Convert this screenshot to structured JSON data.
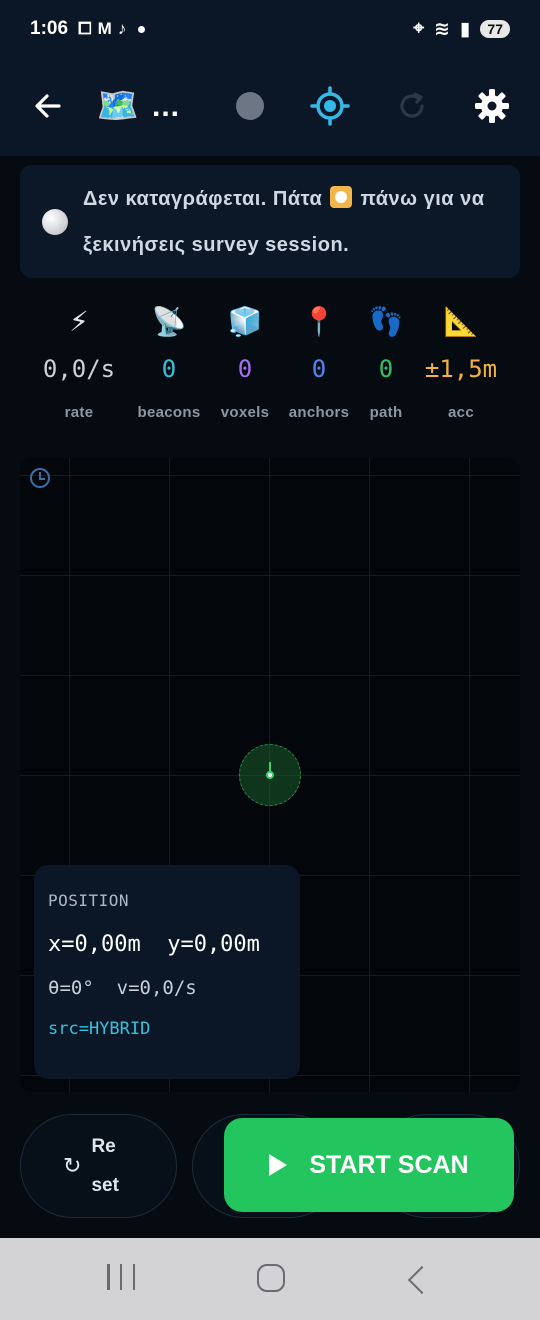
{
  "status_bar": {
    "time": "1:06",
    "battery": "77"
  },
  "toolbar": {
    "map_emoji": "🗺️",
    "more_label": "...",
    "icons": {
      "back": "arrow-left-icon",
      "record": "record-dot-icon",
      "locate": "crosshair-icon",
      "refresh": "refresh-icon",
      "settings": "gear-icon"
    },
    "locate_color": "#34b8e8"
  },
  "banner": {
    "text_before": "Δεν καταγράφεται. Πάτα",
    "text_after": "πάνω για να ξεκινήσεις survey session."
  },
  "stats": [
    {
      "icon": "⚡",
      "value": "0,0/s",
      "label": "rate",
      "color": "#c9d2dd"
    },
    {
      "icon": "📡",
      "value": "0",
      "label": "beacons",
      "color": "#34c3dc"
    },
    {
      "icon": "🧊",
      "value": "0",
      "label": "voxels",
      "color": "#a66ef5"
    },
    {
      "icon": "📍",
      "value": "0",
      "label": "anchors",
      "color": "#4f86f7"
    },
    {
      "icon": "👣",
      "value": "0",
      "label": "path",
      "color": "#2fc45d"
    },
    {
      "icon": "📐",
      "value": "±1,5m",
      "label": "acc",
      "color": "#f2b33a"
    }
  ],
  "position_card": {
    "title": "POSITION",
    "xy": "x=0,00m  y=0,00m",
    "theta_v": "θ=0°  v=0,0/s",
    "src": "src=HYBRID"
  },
  "actions": {
    "reset_label": "Reset",
    "start_label": "START SCAN"
  }
}
